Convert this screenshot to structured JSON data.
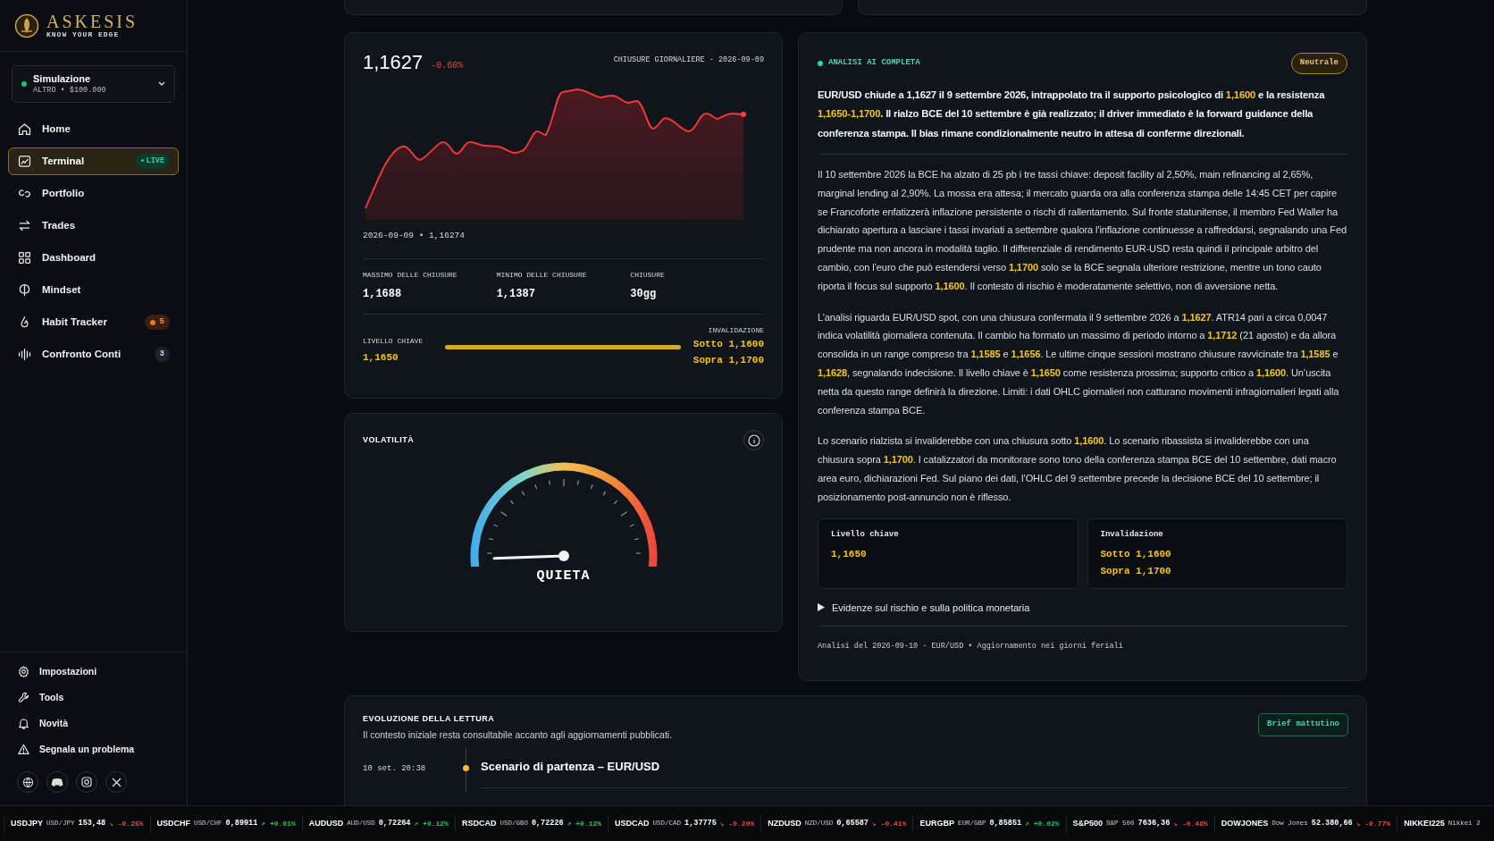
{
  "brand": {
    "name": "ASKESIS",
    "tagline": "KNOW YOUR EDGE"
  },
  "account": {
    "name": "Simulazione",
    "detail": "ALTRO • $100.000"
  },
  "nav": [
    {
      "label": "Home",
      "selected": false
    },
    {
      "label": "Terminal",
      "selected": true,
      "badge": {
        "text": "LIVE",
        "kind": "live"
      }
    },
    {
      "label": "Portfolio",
      "selected": false
    },
    {
      "label": "Trades",
      "selected": false
    },
    {
      "label": "Dashboard",
      "selected": false
    },
    {
      "label": "Mindset",
      "selected": false
    },
    {
      "label": "Habit Tracker",
      "selected": false,
      "badge": {
        "text": "5",
        "kind": "alert"
      }
    },
    {
      "label": "Confronto Conti",
      "selected": false,
      "badge": {
        "text": "3",
        "kind": "count"
      }
    }
  ],
  "footer_nav": [
    {
      "label": "Impostazioni"
    },
    {
      "label": "Tools"
    },
    {
      "label": "Novità"
    },
    {
      "label": "Segnala un problema"
    }
  ],
  "price": {
    "value": "1,1627",
    "change": "-0.60%",
    "caption": "CHIUSURE GIORNALIERE - 2026-09-09",
    "last_point": "2026-09-09 • 1,16274",
    "stats": [
      {
        "label": "MASSIMO DELLE CHIUSURE",
        "value": "1,1688"
      },
      {
        "label": "MINIMO DELLE CHIUSURE",
        "value": "1,1387"
      },
      {
        "label": "CHIUSURE",
        "value": "30gg"
      }
    ],
    "key_level": {
      "label": "LIVELLO CHIAVE",
      "value": "1,1650"
    },
    "invalidation": {
      "label": "INVALIDAZIONE",
      "lines": [
        "Sotto 1,1600",
        "Sopra 1,1700"
      ]
    }
  },
  "volatility": {
    "title": "VOLATILITÀ",
    "label": "QUIETA"
  },
  "analysis": {
    "status": "ANALISI AI COMPLETA",
    "bias": "Neutrale",
    "summary": "EUR/USD chiude a 1,1627 il 9 settembre 2026, intrappolato tra il supporto psicologico di **1,1600** e la resistenza **1,1650-1,1700**. Il rialzo BCE del 10 settembre è già realizzato; il driver immediato è la forward guidance della conferenza stampa. Il bias rimane condizionalmente neutro in attesa di conferme direzionali.",
    "paragraphs": [
      "Il 10 settembre 2026 la BCE ha alzato di 25 pb i tre tassi chiave: deposit facility al 2,50%, main refinancing al 2,65%, marginal lending al 2,90%. La mossa era attesa; il mercato guarda ora alla conferenza stampa delle 14:45 CET per capire se Francoforte enfatizzerà inflazione persistente o rischi di rallentamento. Sul fronte statunitense, il membro Fed Waller ha dichiarato apertura a lasciare i tassi invariati a settembre qualora l'inflazione continuesse a raffreddarsi, segnalando una Fed prudente ma non ancora in modalità taglio. Il differenziale di rendimento EUR-USD resta quindi il principale arbitro del cambio, con l’euro che può estendersi verso **1,1700** solo se la BCE segnala ulteriore restrizione, mentre un tono cauto riporta il focus sul supporto **1,1600**. Il contesto di rischio è moderatamente selettivo, non di avversione netta.",
      "L’analisi riguarda EUR/USD spot, con una chiusura confermata il 9 settembre 2026 a **1,1627**. ATR14 pari a circa 0,0047 indica volatilità giornaliera contenuta. Il cambio ha formato un massimo di periodo intorno a **1,1712** (21 agosto) e da allora consolida in un range compreso tra **1,1585** e **1,1656**. Le ultime cinque sessioni mostrano chiusure ravvicinate tra **1,1585** e **1,1628**, segnalando indecisione. Il livello chiave è **1,1650** come resistenza prossima; supporto critico a **1,1600**. Un’uscita netta da questo range definirà la direzione. Limiti: i dati OHLC giornalieri non catturano movimenti infragiornalieri legati alla conferenza stampa BCE.",
      "Lo scenario rialzista si invaliderebbe con una chiusura sotto **1,1600**. Lo scenario ribassista si invaliderebbe con una chiusura sopra **1,1700**. I catalizzatori da monitorare sono tono della conferenza stampa BCE del 10 settembre, dati macro area euro, dichiarazioni Fed. Sul piano dei dati, l’OHLC del 9 settembre precede la decisione BCE del 10 settembre; il posizionamento post-annuncio non è riflesso."
    ],
    "boxes": [
      {
        "title": "Livello chiave",
        "lines": [
          "1,1650"
        ]
      },
      {
        "title": "Invalidazione",
        "lines": [
          "Sotto 1,1600",
          "Sopra 1,1700"
        ]
      }
    ],
    "details": {
      "label": "Evidenze sul rischio e sulla politica monetaria",
      "expanded": false
    },
    "footer": "Analisi del 2026-09-10 - EUR/USD • Aggiornamento nei giorni feriali"
  },
  "evolution": {
    "title": "EVOLUZIONE DELLA LETTURA",
    "subtitle": "Il contesto iniziale resta consultabile accanto agli aggiornamenti pubblicati.",
    "button": "Brief mattutino",
    "entries": [
      {
        "time": "10 set. 20:38",
        "title": "Scenario di partenza – EUR/USD"
      }
    ]
  },
  "ticker": [
    {
      "symbol": "USDJPY",
      "name": "USD/JPY",
      "price": "153,48",
      "change": "↘ -0.25%",
      "kind": "down"
    },
    {
      "symbol": "USDCHF",
      "name": "USD/CHF",
      "price": "0,89911",
      "change": "↗ +0.01%",
      "kind": "up"
    },
    {
      "symbol": "AUDUSD",
      "name": "AUD/USD",
      "price": "0,72264",
      "change": "↗ +0.12%",
      "kind": "up"
    },
    {
      "symbol": "RSDCAD",
      "name": "USD/GBO",
      "price": "0,72226",
      "change": "↗ +0.12%",
      "kind": "up"
    },
    {
      "symbol": "USDCAD",
      "name": "USD/CAD",
      "price": "1,37775",
      "change": "↘ -0.20%",
      "kind": "down"
    },
    {
      "symbol": "NZDUSD",
      "name": "NZD/USD",
      "price": "0,65587",
      "change": "↘ -0.41%",
      "kind": "down"
    },
    {
      "symbol": "EURGBP",
      "name": "EUR/GBP",
      "price": "0,85851",
      "change": "↗ +0.02%",
      "kind": "up"
    },
    {
      "symbol": "S&P500",
      "name": "S&P 500",
      "price": "7636,36",
      "change": "↘ -0.48%",
      "kind": "down"
    },
    {
      "symbol": "DOWJONES",
      "name": "Dow Jones",
      "price": "52.380,66",
      "change": "↘ -0.77%",
      "kind": "down"
    },
    {
      "symbol": "NIKKEI225",
      "name": "Nikkei 2"
    }
  ]
}
